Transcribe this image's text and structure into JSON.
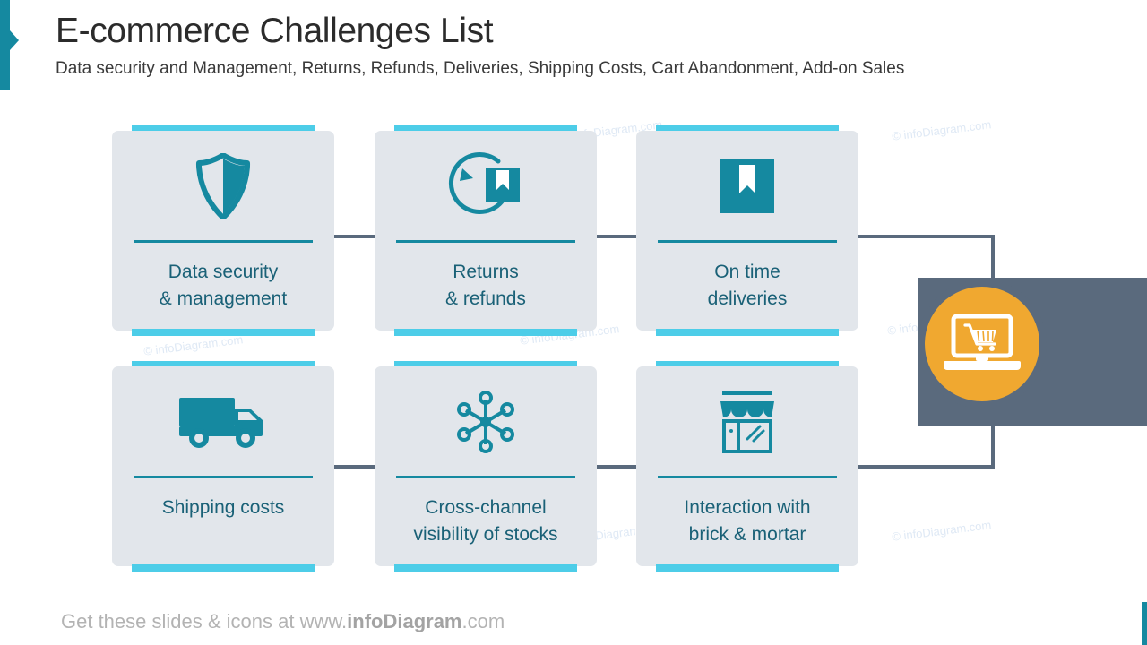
{
  "header": {
    "title": "E-commerce Challenges List",
    "subtitle": "Data security and Management, Returns, Refunds, Deliveries, Shipping Costs, Cart Abandonment, Add-on Sales"
  },
  "colors": {
    "accent_teal": "#1589a0",
    "card_bar_cyan": "#4dcde8",
    "card_background": "#e2e6eb",
    "label_text": "#1a6177",
    "connector_slate": "#5a6a7d",
    "summary_orange": "#f0a830",
    "watermark": "#dfe9f5"
  },
  "cards": [
    {
      "label": "Data security\n& management",
      "icon": "shield-icon"
    },
    {
      "label": "Returns\n& refunds",
      "icon": "returns-arrow-box-icon"
    },
    {
      "label": "On time\ndeliveries",
      "icon": "bookmark-box-icon"
    },
    {
      "label": "Shipping costs",
      "icon": "delivery-truck-icon"
    },
    {
      "label": "Cross-channel\nvisibility of stocks",
      "icon": "network-hub-icon"
    },
    {
      "label": "Interaction with\nbrick & mortar",
      "icon": "storefront-icon"
    }
  ],
  "summary": {
    "icon": "laptop-shopping-cart-icon"
  },
  "watermarks": [
    "© infoDiagram.com",
    "© infoDiagram.com",
    "© infoDiagram.com",
    "© infoDiagram.com",
    "© infoDiagram.com",
    "© infoDiagram.com",
    "© infoDiagram.com"
  ],
  "footer": {
    "prefix": "Get these slides & icons at www.",
    "brand": "infoDiagram",
    "suffix": ".com"
  }
}
